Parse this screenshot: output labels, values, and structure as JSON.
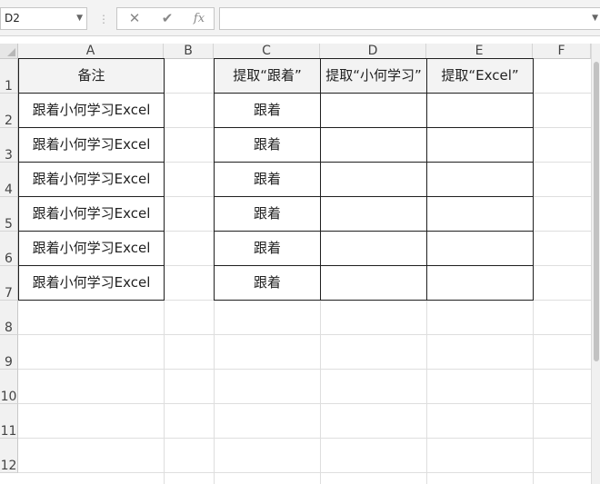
{
  "formula_bar": {
    "name_box": "D2",
    "cancel_icon": "✕",
    "enter_icon": "✔",
    "insert_function_label": "fx",
    "formula_value": ""
  },
  "columns": [
    "A",
    "B",
    "C",
    "D",
    "E",
    "F"
  ],
  "rows": [
    "1",
    "2",
    "3",
    "4",
    "5",
    "6",
    "7",
    "8",
    "9",
    "10",
    "11",
    "12"
  ],
  "table": {
    "headers": {
      "a": "备注",
      "c": "提取“跟着”",
      "d": "提取“小何学习”",
      "e": "提取“Excel”"
    },
    "rows": [
      {
        "a": "跟着小何学习Excel",
        "c": "跟着",
        "d": "",
        "e": ""
      },
      {
        "a": "跟着小何学习Excel",
        "c": "跟着",
        "d": "",
        "e": ""
      },
      {
        "a": "跟着小何学习Excel",
        "c": "跟着",
        "d": "",
        "e": ""
      },
      {
        "a": "跟着小何学习Excel",
        "c": "跟着",
        "d": "",
        "e": ""
      },
      {
        "a": "跟着小何学习Excel",
        "c": "跟着",
        "d": "",
        "e": ""
      },
      {
        "a": "跟着小何学习Excel",
        "c": "跟着",
        "d": "",
        "e": ""
      }
    ]
  },
  "colors": {
    "header_fill": "#f3f3f3",
    "gridline": "#dedede",
    "border": "#1f1f1f"
  }
}
